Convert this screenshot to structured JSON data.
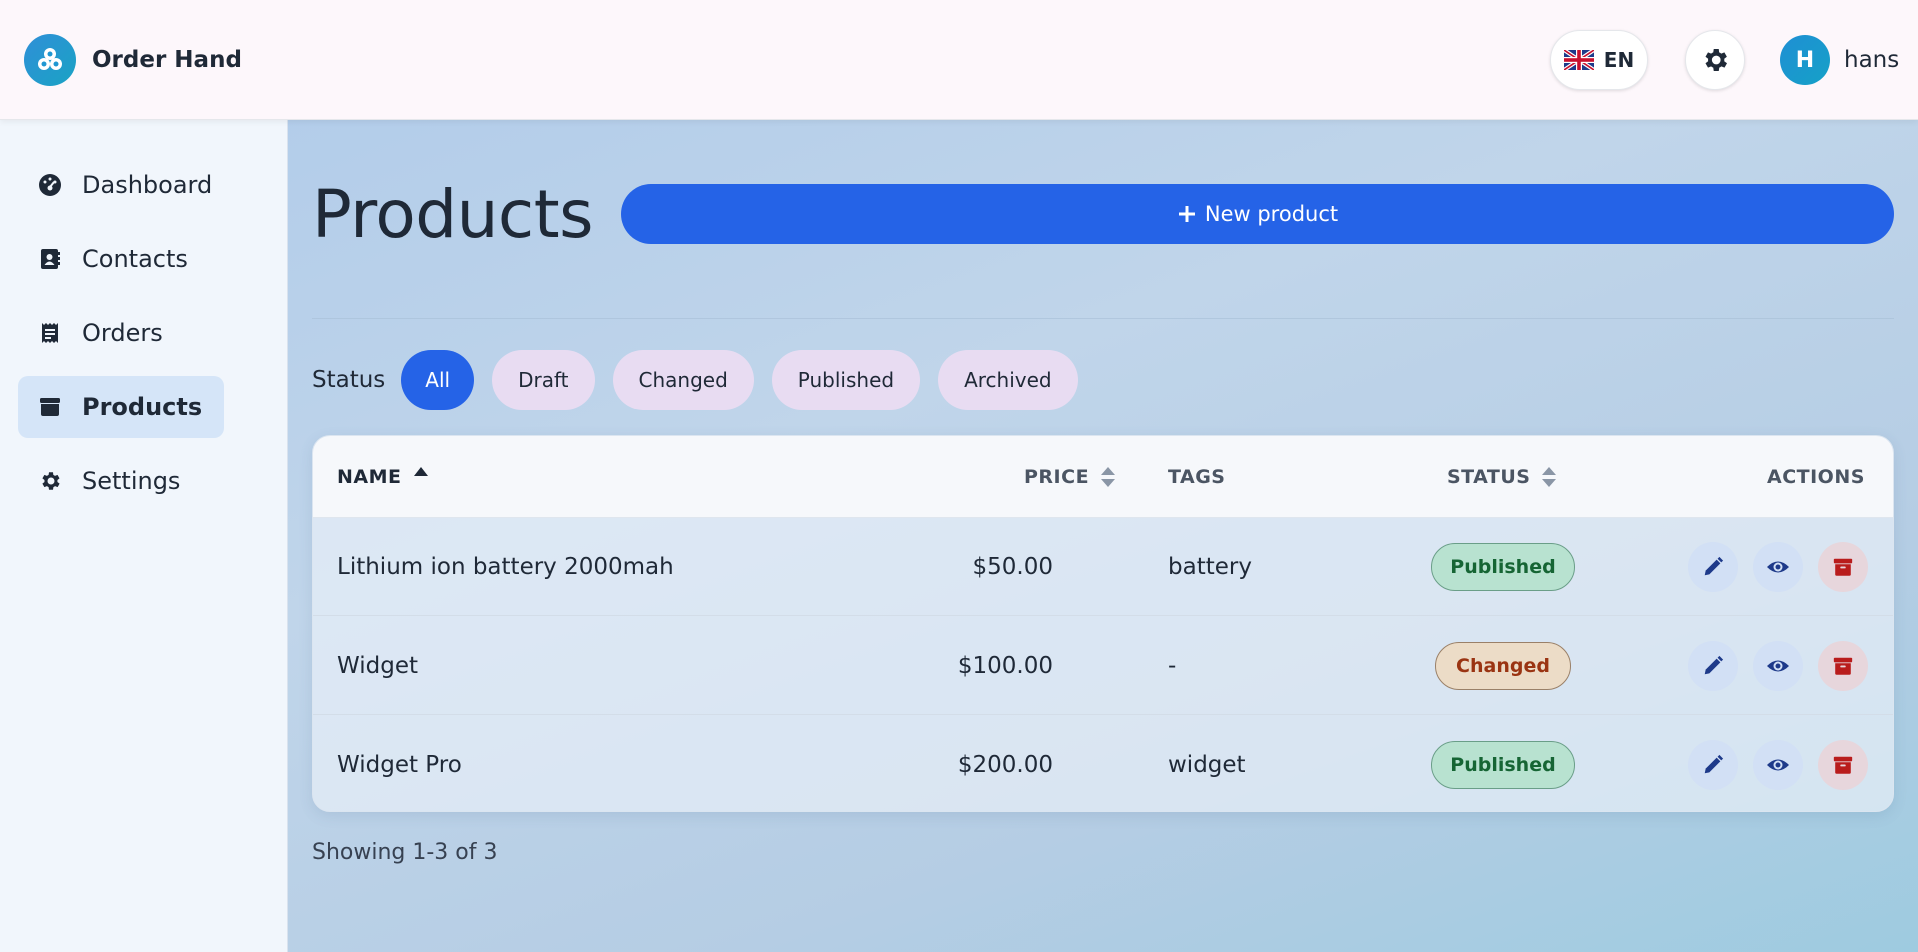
{
  "brand": {
    "name": "Order Hand",
    "logo_icon": "cluster-icon"
  },
  "header": {
    "language": "EN",
    "flag_icon": "uk-flag-icon",
    "settings_icon": "gear-icon",
    "user": {
      "initial": "H",
      "name": "hans"
    }
  },
  "sidebar": {
    "items": [
      {
        "label": "Dashboard",
        "icon": "gauge-icon",
        "active": false
      },
      {
        "label": "Contacts",
        "icon": "address-book-icon",
        "active": false
      },
      {
        "label": "Orders",
        "icon": "receipt-icon",
        "active": false
      },
      {
        "label": "Products",
        "icon": "box-icon",
        "active": true
      },
      {
        "label": "Settings",
        "icon": "gear-icon",
        "active": false
      }
    ]
  },
  "main": {
    "title": "Products",
    "new_button": "New product",
    "filters": {
      "label": "Status",
      "options": [
        "All",
        "Draft",
        "Changed",
        "Published",
        "Archived"
      ],
      "selected": "All"
    },
    "table": {
      "columns": {
        "name": "NAME",
        "price": "PRICE",
        "tags": "TAGS",
        "status": "STATUS",
        "actions": "ACTIONS"
      },
      "rows": [
        {
          "name": "Lithium ion battery 2000mah",
          "price": "$50.00",
          "tags": "battery",
          "status": "Published"
        },
        {
          "name": "Widget",
          "price": "$100.00",
          "tags": "-",
          "status": "Changed"
        },
        {
          "name": "Widget Pro",
          "price": "$200.00",
          "tags": "widget",
          "status": "Published"
        }
      ]
    },
    "pagination": "Showing 1-3 of 3"
  },
  "colors": {
    "accent": "#2563e7",
    "published_bg": "#b8e2d0",
    "published_text": "#166534",
    "changed_bg": "#ecdcc7",
    "changed_text": "#9a3412",
    "archive_icon": "#b91c1c"
  }
}
